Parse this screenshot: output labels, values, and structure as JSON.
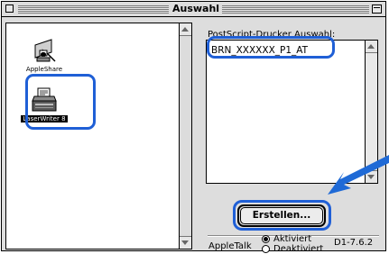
{
  "window": {
    "title": "Auswahl"
  },
  "drivers": [
    {
      "label": "AppleShare",
      "selected": false
    },
    {
      "label": "LaserWriter 8",
      "selected": true
    }
  ],
  "printer_select": {
    "label": "PostScript-Drucker Auswahl:",
    "items": [
      "BRN_XXXXXX_P1_AT"
    ]
  },
  "buttons": {
    "create_label": "Erstellen..."
  },
  "appletalk": {
    "label": "AppleTalk",
    "options": [
      {
        "label": "Aktiviert",
        "selected": true
      },
      {
        "label": "Deaktiviert",
        "selected": false
      }
    ]
  },
  "version": "D1-7.6.2",
  "colors": {
    "highlight": "#1f5fd6",
    "arrow": "#1f6ad6"
  }
}
